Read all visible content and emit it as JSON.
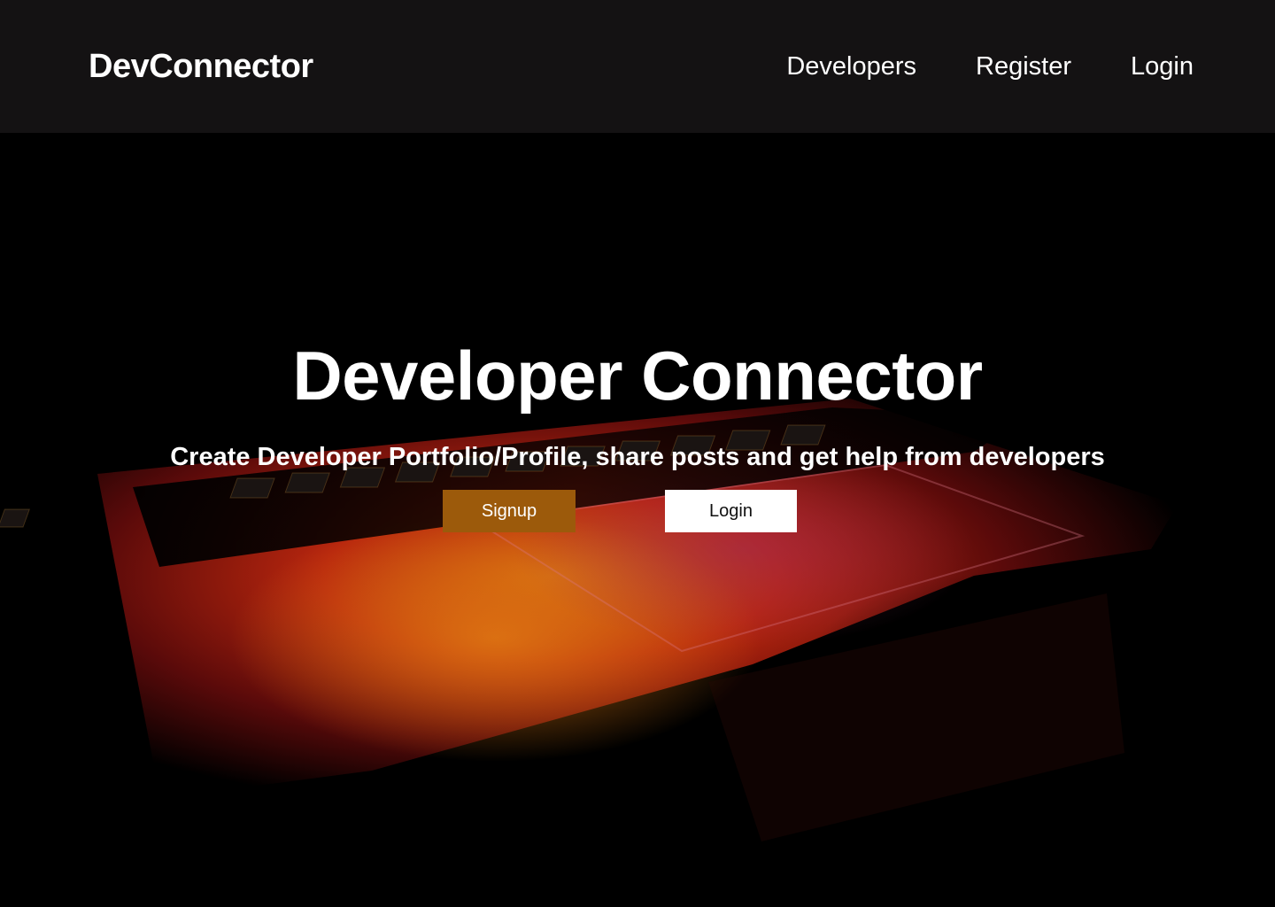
{
  "nav": {
    "brand": "DevConnector",
    "links": [
      {
        "label": "Developers"
      },
      {
        "label": "Register"
      },
      {
        "label": "Login"
      }
    ]
  },
  "hero": {
    "title": "Developer Connector",
    "subtitle": "Create Developer Portfolio/Profile, share posts and get help from developers",
    "signup_label": "Signup",
    "login_label": "Login",
    "background": "laptop-keyboard-photo"
  },
  "colors": {
    "navbar_bg": "#141213",
    "signup_bg": "#9c5a0b",
    "login_bg": "#ffffff",
    "text": "#ffffff"
  }
}
